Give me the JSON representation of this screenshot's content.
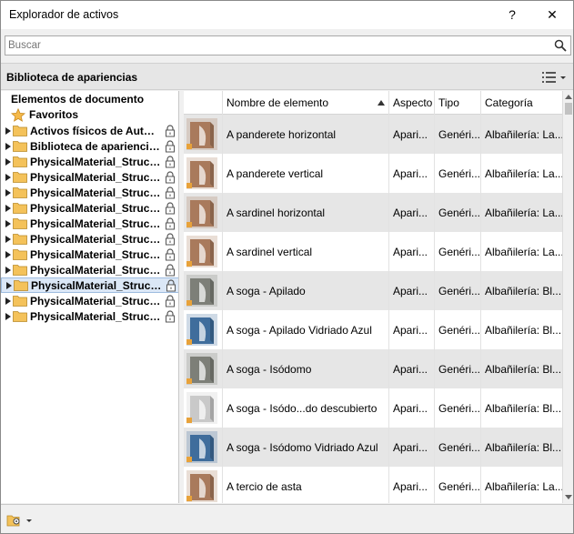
{
  "window": {
    "title": "Explorador de activos",
    "help_label": "?",
    "close_label": "✕"
  },
  "search": {
    "placeholder": "Buscar",
    "value": ""
  },
  "library_bar": {
    "title": "Biblioteca de apariencias"
  },
  "tree": {
    "root_label": "Elementos de documento",
    "favorites_label": "Favoritos",
    "items": [
      {
        "label": "Activos físicos de Autod...",
        "selected": false
      },
      {
        "label": "Biblioteca de apariencias",
        "selected": false
      },
      {
        "label": "PhysicalMaterial_Struct...",
        "selected": false
      },
      {
        "label": "PhysicalMaterial_Struct...",
        "selected": false
      },
      {
        "label": "PhysicalMaterial_Struct...",
        "selected": false
      },
      {
        "label": "PhysicalMaterial_Struct...",
        "selected": false
      },
      {
        "label": "PhysicalMaterial_Struct...",
        "selected": false
      },
      {
        "label": "PhysicalMaterial_Struct...",
        "selected": false
      },
      {
        "label": "PhysicalMaterial_Struct...",
        "selected": false
      },
      {
        "label": "PhysicalMaterial_Struct...",
        "selected": false
      },
      {
        "label": "PhysicalMaterial_Struct...",
        "selected": true
      },
      {
        "label": "PhysicalMaterial_Struct...",
        "selected": false
      },
      {
        "label": "PhysicalMaterial_Struct...",
        "selected": false
      }
    ]
  },
  "grid": {
    "columns": [
      "Nombre de elemento",
      "Aspecto",
      "Tipo",
      "Categoría"
    ],
    "rows": [
      {
        "name": "A panderete horizontal",
        "aspect": "Apari...",
        "type": "Genéri...",
        "category": "Albañilería: La...",
        "thumb": "brick"
      },
      {
        "name": "A panderete vertical",
        "aspect": "Apari...",
        "type": "Genéri...",
        "category": "Albañilería: La...",
        "thumb": "brick"
      },
      {
        "name": "A sardinel horizontal",
        "aspect": "Apari...",
        "type": "Genéri...",
        "category": "Albañilería: La...",
        "thumb": "brick"
      },
      {
        "name": "A sardinel vertical",
        "aspect": "Apari...",
        "type": "Genéri...",
        "category": "Albañilería: La...",
        "thumb": "brick"
      },
      {
        "name": "A soga - Apilado",
        "aspect": "Apari...",
        "type": "Genéri...",
        "category": "Albañilería: Bl...",
        "thumb": "gray"
      },
      {
        "name": "A soga - Apilado Vidriado Azul",
        "aspect": "Apari...",
        "type": "Genéri...",
        "category": "Albañilería: Bl...",
        "thumb": "blue"
      },
      {
        "name": "A soga - Isódomo",
        "aspect": "Apari...",
        "type": "Genéri...",
        "category": "Albañilería: Bl...",
        "thumb": "gray"
      },
      {
        "name": "A soga - Isódo...do descubierto",
        "aspect": "Apari...",
        "type": "Genéri...",
        "category": "Albañilería: Bl...",
        "thumb": "stone"
      },
      {
        "name": "A soga - Isódomo Vidriado Azul",
        "aspect": "Apari...",
        "type": "Genéri...",
        "category": "Albañilería: Bl...",
        "thumb": "blue"
      },
      {
        "name": "A tercio de asta",
        "aspect": "Apari...",
        "type": "Genéri...",
        "category": "Albañilería: La...",
        "thumb": "brick"
      }
    ]
  },
  "colors": {
    "brick": "#a97a5c",
    "gray": "#7d7f78",
    "blue": "#3f6d9c",
    "stone": "#c9c9c9",
    "folder": "#f4c25a",
    "selection": "#dbe7f6"
  }
}
